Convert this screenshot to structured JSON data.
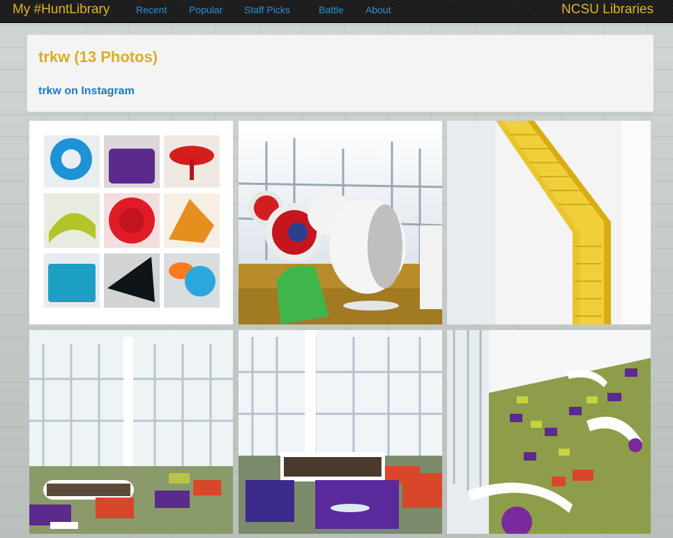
{
  "navbar": {
    "brand": "My #HuntLibrary",
    "links": [
      "Recent",
      "Popular",
      "Staff Picks",
      "Battle",
      "About"
    ],
    "right_brand": "NCSU Libraries"
  },
  "profile": {
    "title": "trkw (13 Photos)",
    "instagram_link": "trkw on Instagram"
  },
  "photos": [
    {
      "subject": "chair collage"
    },
    {
      "subject": "ball chairs by window"
    },
    {
      "subject": "yellow staircase"
    },
    {
      "subject": "reading room with round bookshelves"
    },
    {
      "subject": "purple sofas and bookshelves"
    },
    {
      "subject": "aerial view of colorful seating"
    }
  ],
  "colors": {
    "brand": "#e2b22a",
    "nav_link": "#2f8fd0",
    "title": "#d9ad2b",
    "link": "#1b78c2"
  }
}
